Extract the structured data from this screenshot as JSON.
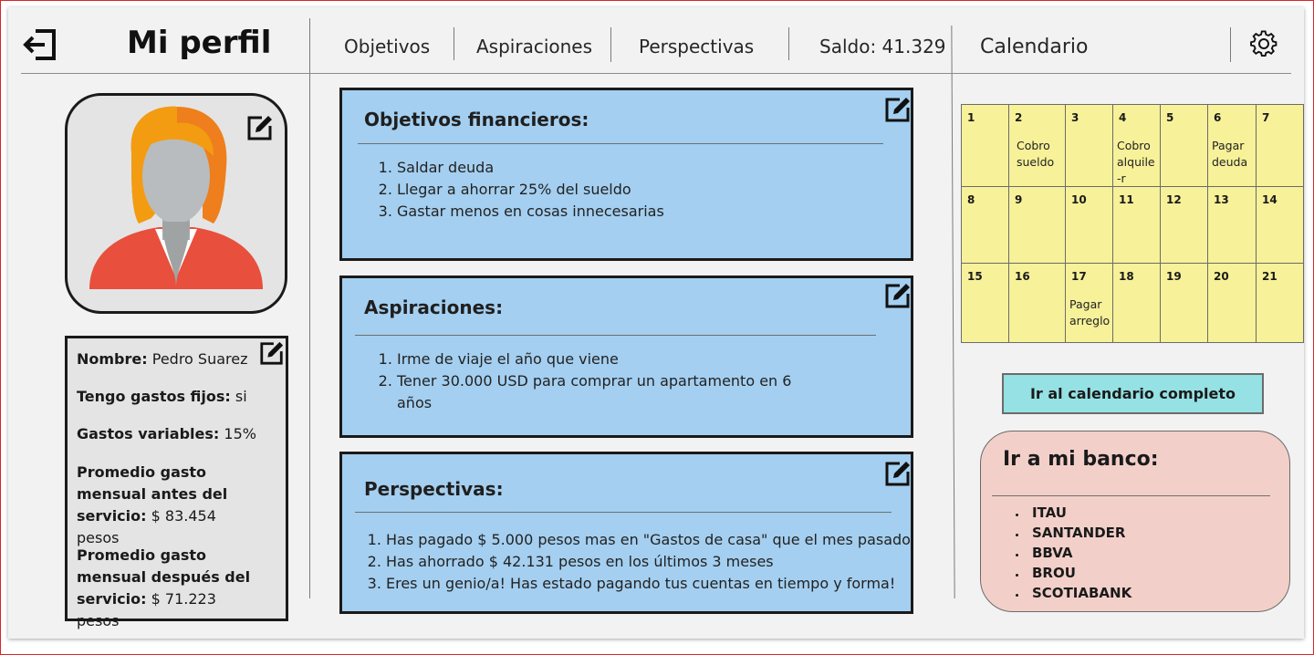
{
  "header": {
    "title": "Mi perfil",
    "nav": [
      "Objetivos",
      "Aspiraciones",
      "Perspectivas"
    ],
    "balance": "Saldo: 41.329",
    "calendar_title": "Calendario"
  },
  "profile": {
    "fields": [
      {
        "label": "Nombre:",
        "value": "Pedro Suarez"
      },
      {
        "label": "Tengo gastos fijos:",
        "value": "si"
      },
      {
        "label": "Gastos variables:",
        "value": "15%"
      },
      {
        "label": "Promedio gasto mensual antes del servicio:",
        "value": "$ 83.454 pesos"
      },
      {
        "label": "Promedio gasto mensual después del servicio:",
        "value": "$ 71.223 pesos"
      }
    ]
  },
  "cards": [
    {
      "title": "Objetivos financieros:",
      "items": [
        "Saldar deuda",
        "Llegar a ahorrar 25% del sueldo",
        "Gastar menos en cosas innecesarias"
      ]
    },
    {
      "title": "Aspiraciones:",
      "items": [
        "Irme de viaje el año que viene",
        "Tener 30.000 USD para comprar un apartamento en 6 años"
      ]
    },
    {
      "title": "Perspectivas:",
      "items": [
        "Has pagado $ 5.000 pesos mas en \"Gastos de casa\" que el mes pasado",
        "Has ahorrado $ 42.131 pesos en los últimos 3 meses",
        "Eres un genio/a! Has estado pagando tus cuentas en tiempo y forma!"
      ]
    }
  ],
  "calendar": {
    "days": [
      {
        "day": "1",
        "note": ""
      },
      {
        "day": "2",
        "note": "Cobro sueldo"
      },
      {
        "day": "3",
        "note": ""
      },
      {
        "day": "4",
        "note": "Cobro alquile-r"
      },
      {
        "day": "5",
        "note": ""
      },
      {
        "day": "6",
        "note": "Pagar deuda"
      },
      {
        "day": "7",
        "note": ""
      },
      {
        "day": "8",
        "note": ""
      },
      {
        "day": "9",
        "note": ""
      },
      {
        "day": "10",
        "note": ""
      },
      {
        "day": "11",
        "note": ""
      },
      {
        "day": "12",
        "note": ""
      },
      {
        "day": "13",
        "note": ""
      },
      {
        "day": "14",
        "note": ""
      },
      {
        "day": "15",
        "note": ""
      },
      {
        "day": "16",
        "note": ""
      },
      {
        "day": "17",
        "note": "Pagar arreglo"
      },
      {
        "day": "18",
        "note": ""
      },
      {
        "day": "19",
        "note": ""
      },
      {
        "day": "20",
        "note": ""
      },
      {
        "day": "21",
        "note": ""
      }
    ],
    "button_label": "Ir al calendario completo"
  },
  "bank": {
    "title": "Ir a mi banco:",
    "banks": [
      "ITAU",
      "SANTANDER",
      "BBVA",
      "BROU",
      "SCOTIABANK"
    ]
  },
  "icons": {
    "logout": "logout-icon",
    "settings": "gear-icon",
    "edit": "edit-icon"
  },
  "colors": {
    "card_bg": "#a4cff0",
    "calendar_bg": "#f7f199",
    "button_bg": "#95e1e4",
    "bank_bg": "#f2d0c9"
  }
}
